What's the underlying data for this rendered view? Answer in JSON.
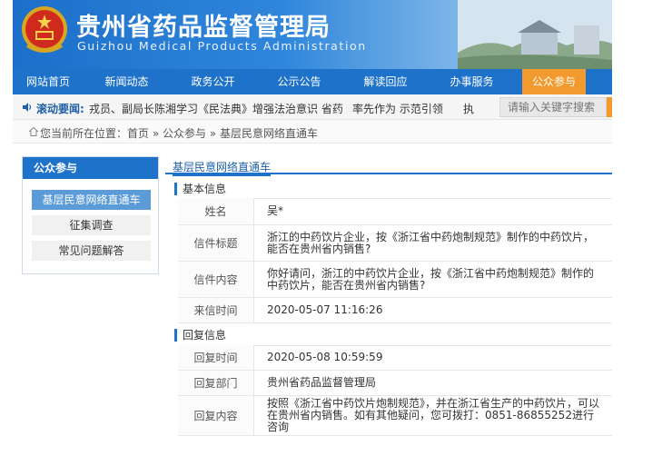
{
  "site": {
    "title": "贵州省药品监督管理局",
    "subtitle": "Guizhou Medical Products Administration"
  },
  "nav": {
    "items": [
      {
        "label": "网站首页"
      },
      {
        "label": "新闻动态"
      },
      {
        "label": "政务公开"
      },
      {
        "label": "公示公告"
      },
      {
        "label": "解读回应"
      },
      {
        "label": "办事服务"
      },
      {
        "label": "公众参与"
      }
    ]
  },
  "ticker": {
    "label": "滚动要闻:",
    "text": "戎员、副局长陈湘学习《民法典》增强法治意识 省药",
    "text2": "率先作为 示范引领",
    "text3": "执"
  },
  "search": {
    "placeholder": "请输入关键字搜索"
  },
  "breadcrumb": {
    "text": "您当前所在位置：首页 » 公众参与 » 基层民意网络直通车"
  },
  "sidebar": {
    "title": "公众参与",
    "items": [
      {
        "label": "基层民意网络直通车"
      },
      {
        "label": "征集调查"
      },
      {
        "label": "常见问题解答"
      }
    ]
  },
  "main": {
    "tab": "基层民意网络直通车",
    "basic_section": "基本信息",
    "basic_rows": [
      {
        "label": "姓名",
        "value": "吴*"
      },
      {
        "label": "信件标题",
        "value": "浙江的中药饮片企业，按《浙江省中药炮制规范》制作的中药饮片，能否在贵州省内销售?"
      },
      {
        "label": "信件内容",
        "value": "你好请问，浙江的中药饮片企业，按《浙江省中药炮制规范》制作的中药饮片，能否在贵州省内销售?"
      },
      {
        "label": "来信时间",
        "value": "2020-05-07 11:16:26"
      }
    ],
    "reply_section": "回复信息",
    "reply_rows": [
      {
        "label": "回复时间",
        "value": "2020-05-08 10:59:59"
      },
      {
        "label": "回复部门",
        "value": "贵州省药品监督管理局"
      },
      {
        "label": "回复内容",
        "value": "按照《浙江省中药饮片炮制规范》，并在浙江省生产的中药饮片，可以在贵州省内销售。如有其他疑问，您可拨打：0851-86855252进行咨询"
      }
    ]
  },
  "colors": {
    "brand_blue": "#1f72c9",
    "accent_orange": "#f39a2e"
  }
}
